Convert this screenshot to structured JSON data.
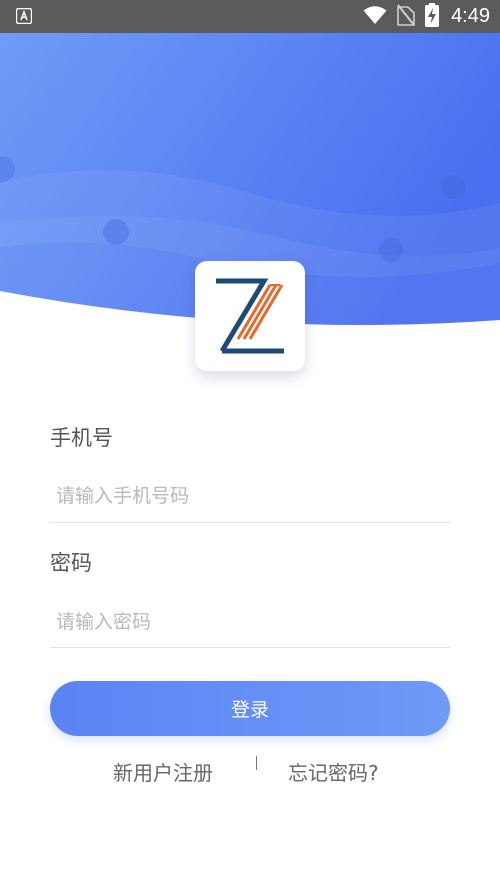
{
  "status_bar": {
    "time": "4:49",
    "icons": [
      "app-notification-icon",
      "wifi-icon",
      "no-sim-icon",
      "battery-charging-icon"
    ]
  },
  "logo": {
    "letter": "Z"
  },
  "form": {
    "phone_label": "手机号",
    "phone_placeholder": "请输入手机号码",
    "password_label": "密码",
    "password_placeholder": "请输入密码"
  },
  "login_button": "登录",
  "links": {
    "register": "新用户注册",
    "forgot": "忘记密码?"
  },
  "colors": {
    "status_bar": "#5b5b5b",
    "hero_blue": "#4f78f1",
    "button": "#5e8af5",
    "logo_dark": "#1d4a78",
    "logo_orange": "#e66a2c"
  }
}
